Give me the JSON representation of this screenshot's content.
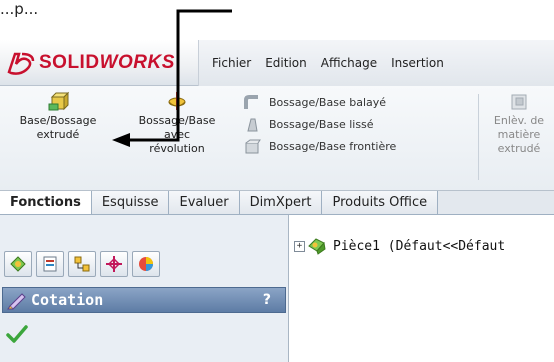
{
  "header": {
    "text": "...p..."
  },
  "app": {
    "brand_bold": "SOLID",
    "brand_italic": "WORKS",
    "menu": [
      "Fichier",
      "Edition",
      "Affichage",
      "Insertion"
    ]
  },
  "ribbon": {
    "extrude_label_1": "Base/Bossage",
    "extrude_label_2": "extrudé",
    "revolve_label_1": "Bossage/Base",
    "revolve_label_2": "avec",
    "revolve_label_3": "révolution",
    "small_items": [
      "Bossage/Base balayé",
      "Bossage/Base lissé",
      "Bossage/Base frontière"
    ],
    "cut_label_1": "Enlèv. de",
    "cut_label_2": "matière",
    "cut_label_3": "extrudé"
  },
  "tabs": [
    "Fonctions",
    "Esquisse",
    "Evaluer",
    "DimXpert",
    "Produits Office"
  ],
  "panel": {
    "title": "Cotation",
    "help": "?"
  },
  "tree": {
    "expander": "+",
    "item": "Pièce1 (Défaut<<Défaut"
  },
  "colors": {
    "brand_red": "#c8102e",
    "panel_title_bg": "#6f8bb2",
    "annotation_line": "#000000"
  }
}
